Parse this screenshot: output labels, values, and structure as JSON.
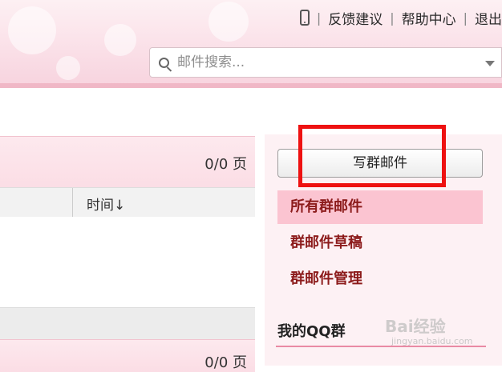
{
  "header": {
    "links": {
      "feedback": "反馈建议",
      "help": "帮助中心",
      "logout": "退出"
    }
  },
  "search": {
    "placeholder": "邮件搜索..."
  },
  "list": {
    "pager_top": "0/0 页",
    "time_column": "时间↓",
    "pager_bottom": "0/0 页"
  },
  "sidebar": {
    "compose_label": "写群邮件",
    "items": [
      {
        "label": "所有群邮件",
        "active": true
      },
      {
        "label": "群邮件草稿",
        "active": false
      },
      {
        "label": "群邮件管理",
        "active": false
      }
    ],
    "section_title": "我的QQ群"
  },
  "watermark": {
    "brand": "Bai经验",
    "url": "jingyan.baidu.com"
  },
  "colors": {
    "accent_pink": "#fbc4d1",
    "nav_text": "#8c1b1b",
    "highlight_red": "#ee1111"
  },
  "icons": [
    "phone-icon",
    "search-icon",
    "chevron-down-icon"
  ]
}
